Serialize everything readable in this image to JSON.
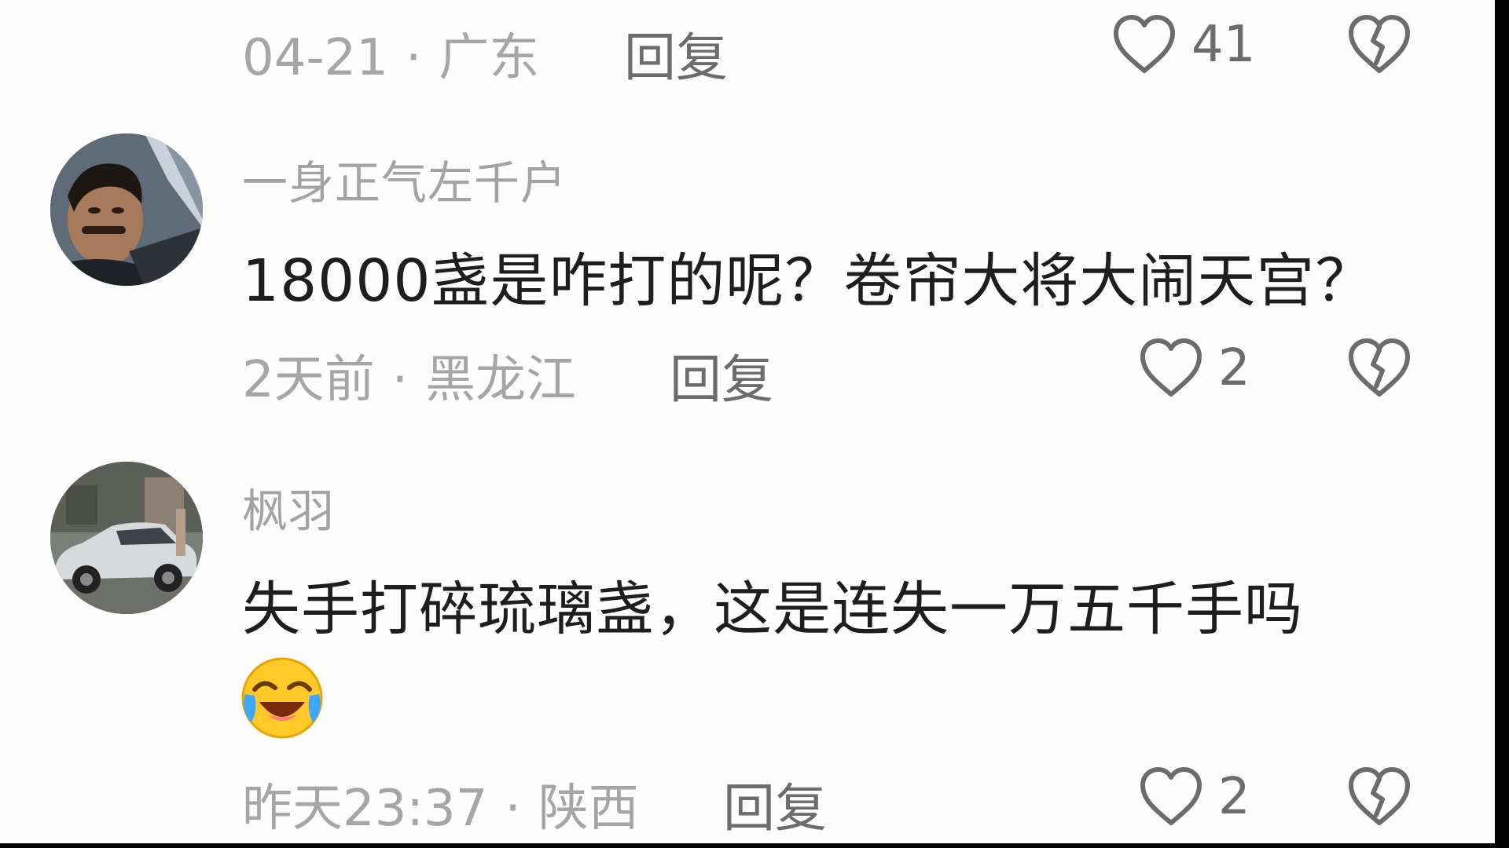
{
  "comments": [
    {
      "date": "04-21",
      "separator": "·",
      "location": "广东",
      "reply_label": "回复",
      "likes": "41",
      "like_icon": "heart-outline-icon",
      "dislike_icon": "broken-heart-icon"
    },
    {
      "username": "一身正气左千户",
      "text": "18000盏是咋打的呢？卷帘大将大闹天宫？",
      "date": "2天前",
      "separator": "·",
      "location": "黑龙江",
      "reply_label": "回复",
      "likes": "2",
      "avatar_icon": "user-avatar-man",
      "like_icon": "heart-outline-icon",
      "dislike_icon": "broken-heart-icon"
    },
    {
      "username": "枫羽",
      "text": "失手打碎琉璃盏，这是连失一万五千手吗",
      "emoji": "laugh-crying-emoji",
      "date": "昨天23:37",
      "separator": "·",
      "location": "陕西",
      "reply_label": "回复",
      "likes": "2",
      "avatar_icon": "user-avatar-car",
      "like_icon": "heart-outline-icon",
      "dislike_icon": "broken-heart-icon"
    }
  ],
  "colors": {
    "background": "#fdfdfd",
    "username": "#a3a3a3",
    "content": "#1e1e1e",
    "meta": "#a6a6a6",
    "action": "#6c6c6c"
  }
}
